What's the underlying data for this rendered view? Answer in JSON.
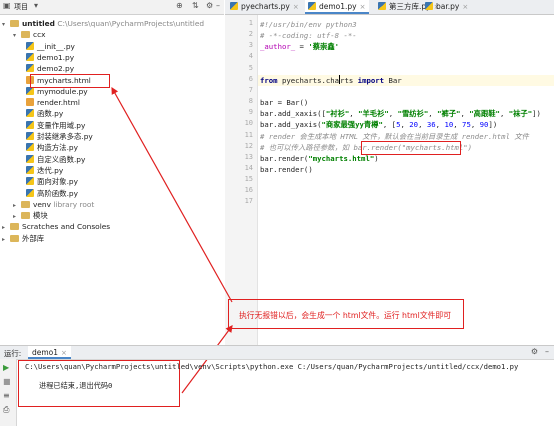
{
  "project_panel": {
    "title": "项目",
    "tree": [
      {
        "level": 0,
        "type": "folder",
        "expanded": true,
        "name": "untitled",
        "note": "C:\\Users\\quan\\PycharmProjects\\untitled"
      },
      {
        "level": 1,
        "type": "folder",
        "expanded": true,
        "name": "ccx"
      },
      {
        "level": 2,
        "type": "py",
        "name": "__init__.py"
      },
      {
        "level": 2,
        "type": "py",
        "name": "demo1.py"
      },
      {
        "level": 2,
        "type": "py",
        "name": "demo2.py"
      },
      {
        "level": 2,
        "type": "html",
        "name": "mycharts.html",
        "highlighted": true
      },
      {
        "level": 2,
        "type": "py",
        "name": "mymodule.py"
      },
      {
        "level": 2,
        "type": "html",
        "name": "render.html"
      },
      {
        "level": 2,
        "type": "py",
        "name": "函数.py"
      },
      {
        "level": 2,
        "type": "py",
        "name": "变量作用域.py"
      },
      {
        "level": 2,
        "type": "py",
        "name": "封装继承多态.py"
      },
      {
        "level": 2,
        "type": "py",
        "name": "构造方法.py"
      },
      {
        "level": 2,
        "type": "py",
        "name": "自定义函数.py"
      },
      {
        "level": 2,
        "type": "py",
        "name": "迭代.py"
      },
      {
        "level": 2,
        "type": "py",
        "name": "面向对象.py"
      },
      {
        "level": 2,
        "type": "py",
        "name": "高阶函数.py"
      },
      {
        "level": 1,
        "type": "folder",
        "expanded": false,
        "name": "venv",
        "note": "library root"
      },
      {
        "level": 1,
        "type": "folder",
        "expanded": false,
        "name": "模块"
      },
      {
        "level": 0,
        "type": "scratch",
        "expanded": false,
        "name": "Scratches and Consoles"
      },
      {
        "level": 0,
        "type": "lib",
        "expanded": false,
        "name": "外部库"
      }
    ]
  },
  "editor": {
    "tabs": [
      {
        "label": "pyecharts.py",
        "active": false
      },
      {
        "label": "demo1.py",
        "active": true
      },
      {
        "label": "第三方库.py",
        "active": false
      },
      {
        "label": "bar.py",
        "active": false
      }
    ],
    "line_count": 17,
    "current_line": 6,
    "lines": [
      [
        {
          "t": "#!/usr/bin/env python3",
          "c": "cmt"
        }
      ],
      [
        {
          "t": "# -*-coding: utf-8 -*-",
          "c": "cmt"
        }
      ],
      [
        {
          "t": "_author_",
          "c": "dunder"
        },
        {
          "t": " = ",
          "c": ""
        },
        {
          "t": "'蔡崇鑫'",
          "c": "str"
        }
      ],
      [],
      [],
      [
        {
          "t": "from ",
          "c": "kw"
        },
        {
          "t": "pyecharts.cha",
          "c": ""
        },
        {
          "t": "|",
          "c": "caret"
        },
        {
          "t": "rts ",
          "c": ""
        },
        {
          "t": "import ",
          "c": "kw"
        },
        {
          "t": "Bar",
          "c": ""
        }
      ],
      [],
      [
        {
          "t": "bar = Bar()",
          "c": ""
        }
      ],
      [
        {
          "t": "bar.add_xaxis([",
          "c": ""
        },
        {
          "t": "\"衬衫\"",
          "c": "str"
        },
        {
          "t": ", ",
          "c": ""
        },
        {
          "t": "\"羊毛衫\"",
          "c": "str"
        },
        {
          "t": ", ",
          "c": ""
        },
        {
          "t": "\"雪纺衫\"",
          "c": "str"
        },
        {
          "t": ", ",
          "c": ""
        },
        {
          "t": "\"裤子\"",
          "c": "str"
        },
        {
          "t": ", ",
          "c": ""
        },
        {
          "t": "\"高跟鞋\"",
          "c": "str"
        },
        {
          "t": ", ",
          "c": ""
        },
        {
          "t": "\"袜子\"",
          "c": "str"
        },
        {
          "t": "])",
          "c": ""
        }
      ],
      [
        {
          "t": "bar.add_yaxis(",
          "c": ""
        },
        {
          "t": "\"商家最强yy青樽\"",
          "c": "str"
        },
        {
          "t": ", [",
          "c": ""
        },
        {
          "t": "5",
          "c": "num"
        },
        {
          "t": ", ",
          "c": ""
        },
        {
          "t": "20",
          "c": "num"
        },
        {
          "t": ", ",
          "c": ""
        },
        {
          "t": "36",
          "c": "num"
        },
        {
          "t": ", ",
          "c": ""
        },
        {
          "t": "10",
          "c": "num"
        },
        {
          "t": ", ",
          "c": ""
        },
        {
          "t": "75",
          "c": "num"
        },
        {
          "t": ", ",
          "c": ""
        },
        {
          "t": "90",
          "c": "num"
        },
        {
          "t": "])",
          "c": ""
        }
      ],
      [
        {
          "t": "# render 会生成本地 HTML 文件，默认会在当前目录生成 render.html 文件",
          "c": "cmt"
        }
      ],
      [
        {
          "t": "# 也可以传入路径参数，如 bar.render(\"mycharts.html\")",
          "c": "cmt"
        }
      ],
      [
        {
          "t": "bar.render(",
          "c": ""
        },
        {
          "t": "\"mycharts.html\"",
          "c": "str"
        },
        {
          "t": ")",
          "c": ""
        }
      ],
      [
        {
          "t": "bar.render()",
          "c": ""
        }
      ]
    ]
  },
  "annotation_text": "执行无报错以后，会生成一个 html文件。运行 html文件即可",
  "run_panel": {
    "label": "运行:",
    "tab": "demo1",
    "command": "C:\\Users\\quan\\PycharmProjects\\untitled\\venv\\Scripts\\python.exe C:/Users/quan/PycharmProjects/untitled/ccx/demo1.py",
    "result": "进程已结束,退出代码0"
  }
}
